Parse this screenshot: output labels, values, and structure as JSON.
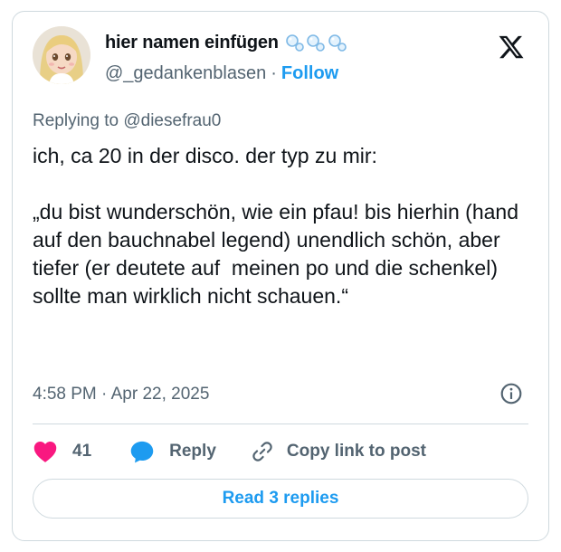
{
  "author": {
    "display_name": "hier namen einfügen",
    "handle": "@_gedankenblasen",
    "separator": "·",
    "follow_label": "Follow"
  },
  "reply_context": {
    "prefix": "Replying to ",
    "mention": "@diesefrau0"
  },
  "tweet": {
    "text": "ich, ca 20 in der disco. der typ zu mir:\n\n„du bist wunderschön, wie ein pfau! bis hierhin (hand auf den bauchnabel legend) unendlich schön, aber tiefer (er deutete auf  meinen po und die schenkel) sollte man wirklich nicht schauen.“",
    "timestamp": "4:58 PM · Apr 22, 2025"
  },
  "actions": {
    "like_count": "41",
    "reply_label": "Reply",
    "copy_label": "Copy link to post"
  },
  "footer": {
    "read_replies_label": "Read 3 replies"
  },
  "colors": {
    "accent": "#1d9bf0",
    "like": "#f91880",
    "text": "#0f1419",
    "muted": "#536471",
    "border": "#cfd9de"
  },
  "icons": [
    "x-logo-icon",
    "info-icon",
    "heart-icon",
    "reply-bubble-icon",
    "link-icon",
    "bubbles-icon"
  ]
}
